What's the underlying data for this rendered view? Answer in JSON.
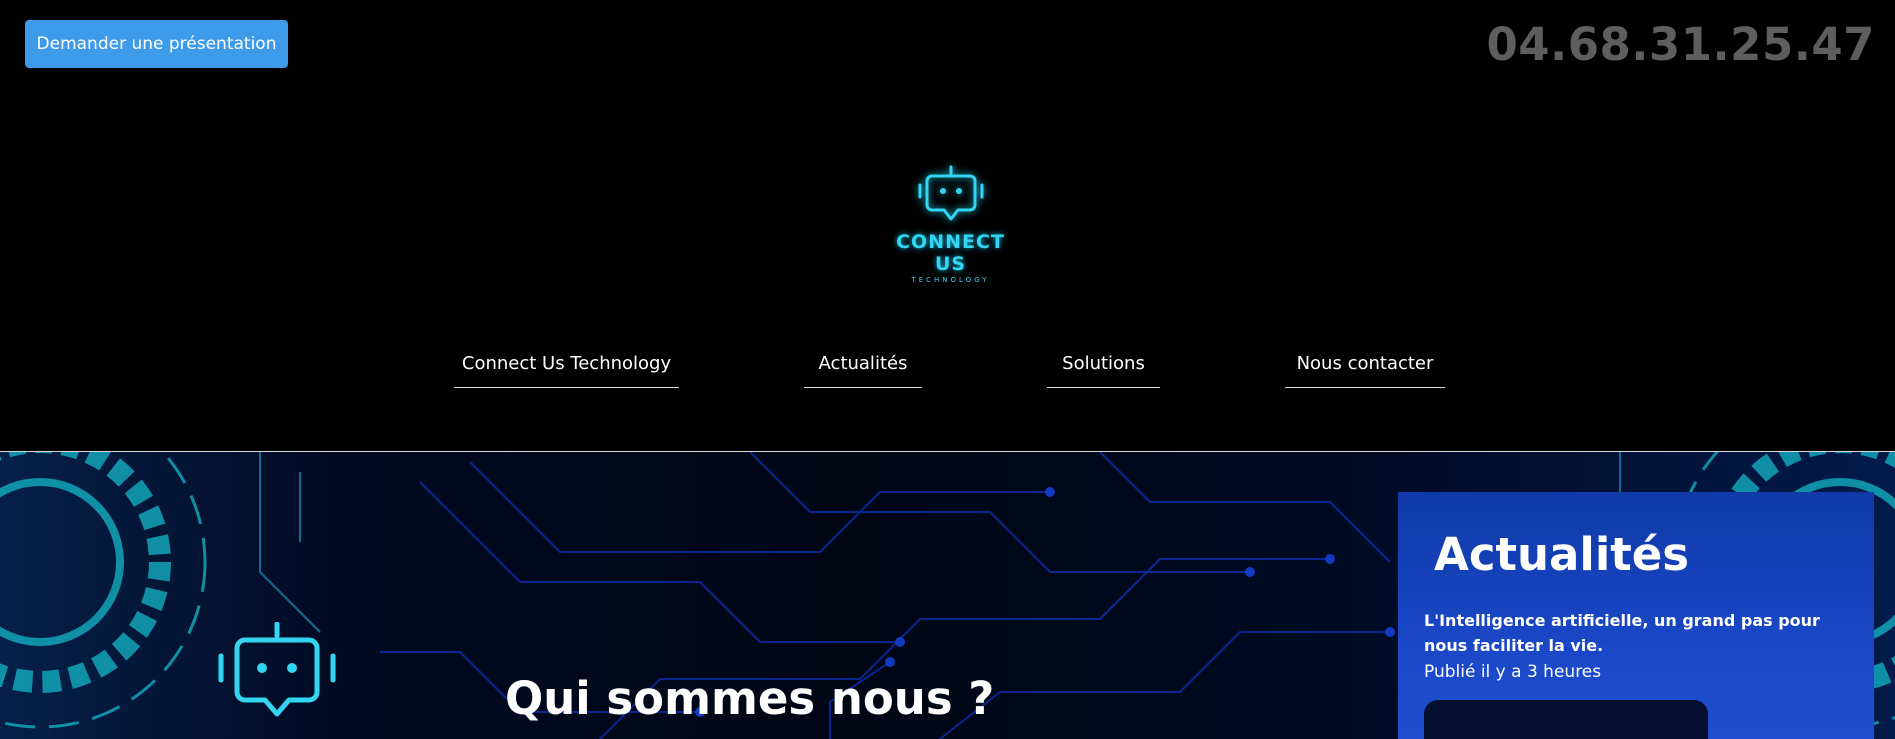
{
  "header": {
    "cta_label": "Demander une présentation",
    "phone": "04.68.31.25.47"
  },
  "logo": {
    "icon": "robot-chat-icon",
    "name": "CONNECT US",
    "subtitle": "TECHNOLOGY",
    "color": "#33d6f2"
  },
  "nav": {
    "items": [
      {
        "label": "Connect Us Technology"
      },
      {
        "label": "Actualités"
      },
      {
        "label": "Solutions"
      },
      {
        "label": "Nous contacter"
      }
    ]
  },
  "hero": {
    "title": "Qui sommes nous ?",
    "icon": "robot-chat-icon"
  },
  "news": {
    "title": "Actualités",
    "headline": "L'Intelligence artificielle, un grand pas pour nous faciliter la vie.",
    "meta": "Publié il y a 3 heures"
  },
  "colors": {
    "accent": "#3d9be9",
    "phone": "#5e5e5e",
    "cyan": "#33d6f2",
    "panel": "#1a47c6"
  }
}
